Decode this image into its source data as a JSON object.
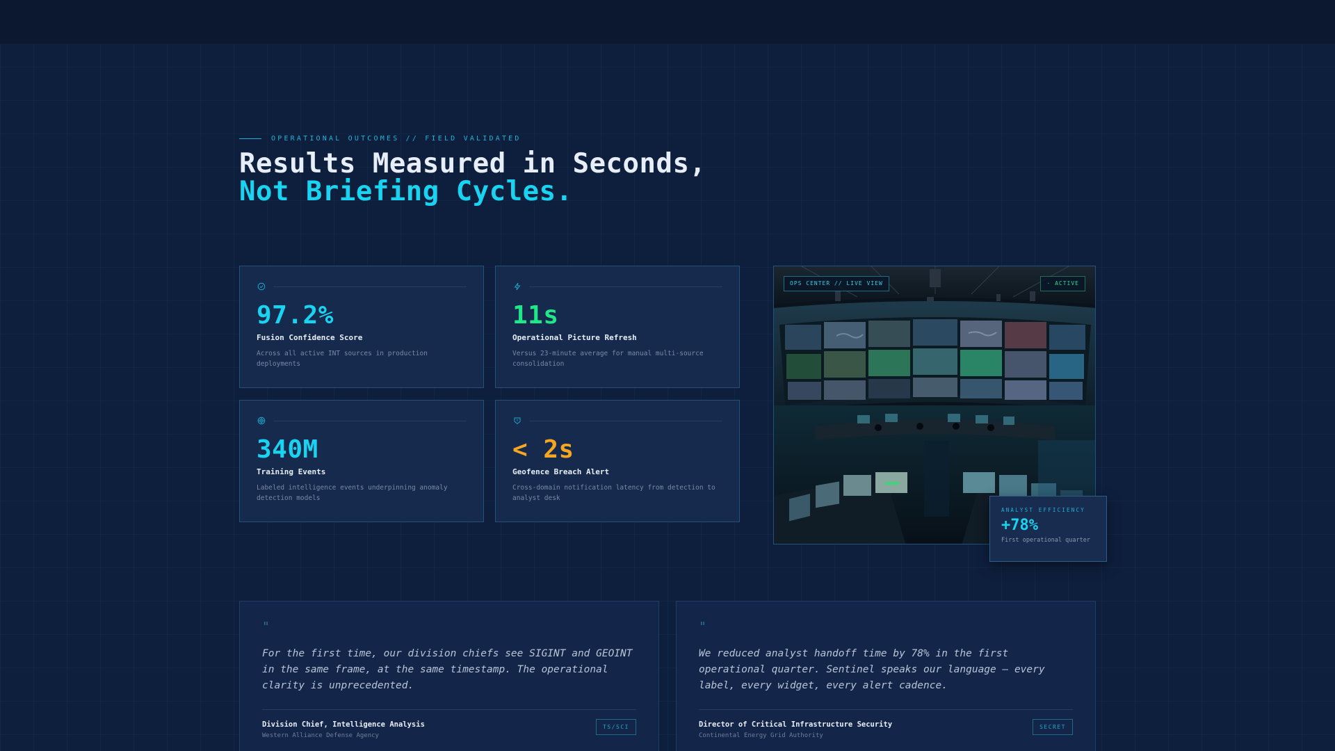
{
  "eyebrow": "OPERATIONAL OUTCOMES // FIELD VALIDATED",
  "headline": {
    "line1": "Results Measured in Seconds,",
    "line2": "Not Briefing Cycles."
  },
  "stats": [
    {
      "icon": "check-circle-icon",
      "value": "97.2%",
      "label": "Fusion Confidence Score",
      "desc": "Across all active INT sources in production deployments",
      "color": "#19d3f0"
    },
    {
      "icon": "lightning-icon",
      "value": "11s",
      "label": "Operational Picture Refresh",
      "desc": "Versus 23-minute average for manual multi-source consolidation",
      "color": "#1ee887"
    },
    {
      "icon": "database-icon",
      "value": "340M",
      "label": "Training Events",
      "desc": "Labeled intelligence events underpinning anomaly detection models",
      "color": "#19d3f0"
    },
    {
      "icon": "alert-shield-icon",
      "value": "< 2s",
      "label": "Geofence Breach Alert",
      "desc": "Cross-domain notification latency from detection to analyst desk",
      "color": "#f5a623"
    }
  ],
  "image": {
    "tag_left": "OPS CENTER // LIVE VIEW",
    "tag_right": "· ACTIVE",
    "overlay_title": "ANALYST EFFICIENCY",
    "overlay_value": "+78%",
    "overlay_sub": "First operational quarter"
  },
  "quotes": [
    {
      "mark": "\"",
      "text": "For the first time, our division chiefs see SIGINT and GEOINT in the same frame, at the same timestamp. The operational clarity is unprecedented.",
      "name": "Division Chief, Intelligence Analysis",
      "org": "Western Alliance Defense Agency",
      "badge": "TS/SCI"
    },
    {
      "mark": "\"",
      "text": "We reduced analyst handoff time by 78% in the first operational quarter. Sentinel speaks our language — every label, every widget, every alert cadence.",
      "name": "Director of Critical Infrastructure Security",
      "org": "Continental Energy Grid Authority",
      "badge": "SECRET"
    }
  ]
}
